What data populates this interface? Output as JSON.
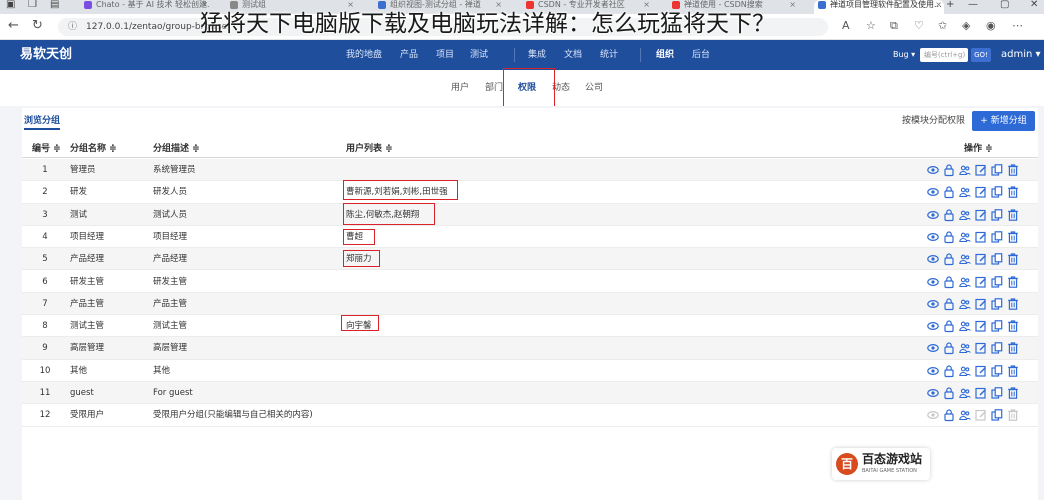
{
  "overlay_title": "猛将天下电脑版下载及电脑玩法详解：怎么玩猛将天下？",
  "browser": {
    "tabs": [
      {
        "label": "Chato - 基于 AI 技术 轻松创建...",
        "favicon_color": "#7b4ee0"
      },
      {
        "label": "测试组",
        "favicon_color": "#888"
      },
      {
        "label": "组织视图-测试分组 - 禅道",
        "favicon_color": "#3d6fd1"
      },
      {
        "label": "CSDN - 专业开发者社区",
        "favicon_color": "#e33"
      },
      {
        "label": "禅道使用 - CSDN搜索",
        "favicon_color": "#e33"
      },
      {
        "label": "禅道项目管理软件配置及使用...",
        "favicon_color": "#3d6fd1"
      }
    ],
    "url": "127.0.0.1/zentao/group-browse"
  },
  "app": {
    "logo": "易软天创",
    "nav": [
      {
        "label": "我的地盘",
        "active": false
      },
      {
        "label": "产品",
        "active": false
      },
      {
        "label": "项目",
        "active": false
      },
      {
        "label": "测试",
        "active": false
      },
      {
        "label": "集成",
        "active": false
      },
      {
        "label": "文档",
        "active": false
      },
      {
        "label": "统计",
        "active": false
      },
      {
        "label": "组织",
        "active": true
      },
      {
        "label": "后台",
        "active": false
      }
    ],
    "search_type": "Bug ▾",
    "search_placeholder": "编号(ctrl+g)",
    "go_label": "GO!",
    "user": "admin ▾"
  },
  "subnav": [
    {
      "label": "用户",
      "active": false
    },
    {
      "label": "部门",
      "active": false
    },
    {
      "label": "权限",
      "active": true
    },
    {
      "label": "动态",
      "active": false
    },
    {
      "label": "公司",
      "active": false
    }
  ],
  "toolbar": {
    "browse_tab": "浏览分组",
    "assign_link": "按模块分配权限",
    "add_button": "+ 新增分组"
  },
  "table": {
    "headers": {
      "id": "编号 ≑",
      "name": "分组名称 ≑",
      "desc": "分组描述 ≑",
      "users": "用户列表 ≑",
      "ops": "操作 ≑"
    },
    "rows": [
      {
        "id": "1",
        "name": "管理员",
        "desc": "系统管理员",
        "users": "",
        "ops_disabled": false
      },
      {
        "id": "2",
        "name": "研发",
        "desc": "研发人员",
        "users": "曹新源,刘若娟,刘彬,田世强",
        "ops_disabled": false
      },
      {
        "id": "3",
        "name": "测试",
        "desc": "测试人员",
        "users": "陈尘,何敏杰,赵朝翔",
        "ops_disabled": false
      },
      {
        "id": "4",
        "name": "项目经理",
        "desc": "项目经理",
        "users": "曹超",
        "ops_disabled": false
      },
      {
        "id": "5",
        "name": "产品经理",
        "desc": "产品经理",
        "users": "郑丽力",
        "ops_disabled": false
      },
      {
        "id": "6",
        "name": "研发主管",
        "desc": "研发主管",
        "users": "",
        "ops_disabled": false
      },
      {
        "id": "7",
        "name": "产品主管",
        "desc": "产品主管",
        "users": "",
        "ops_disabled": false
      },
      {
        "id": "8",
        "name": "测试主管",
        "desc": "测试主管",
        "users": "向宇馨",
        "ops_disabled": false
      },
      {
        "id": "9",
        "name": "高层管理",
        "desc": "高层管理",
        "users": "",
        "ops_disabled": false
      },
      {
        "id": "10",
        "name": "其他",
        "desc": "其他",
        "users": "",
        "ops_disabled": false
      },
      {
        "id": "11",
        "name": "guest",
        "desc": "For guest",
        "users": "",
        "ops_disabled": false
      },
      {
        "id": "12",
        "name": "受限用户",
        "desc": "受限用户分组(只能编辑与自己相关的内容)",
        "users": "",
        "ops_disabled": true
      }
    ],
    "op_icons": [
      "view-icon",
      "lock-icon",
      "users-icon",
      "edit-icon",
      "copy-icon",
      "delete-icon"
    ]
  },
  "watermark": {
    "text": "百态游戏站",
    "sub": "BAITAI GAME STATION",
    "badge_glyph": "百"
  },
  "colors": {
    "header_bg": "#1f4e9d",
    "accent": "#2e6ad6",
    "highlight": "#d8232a",
    "icon": "#2e6ad6"
  }
}
